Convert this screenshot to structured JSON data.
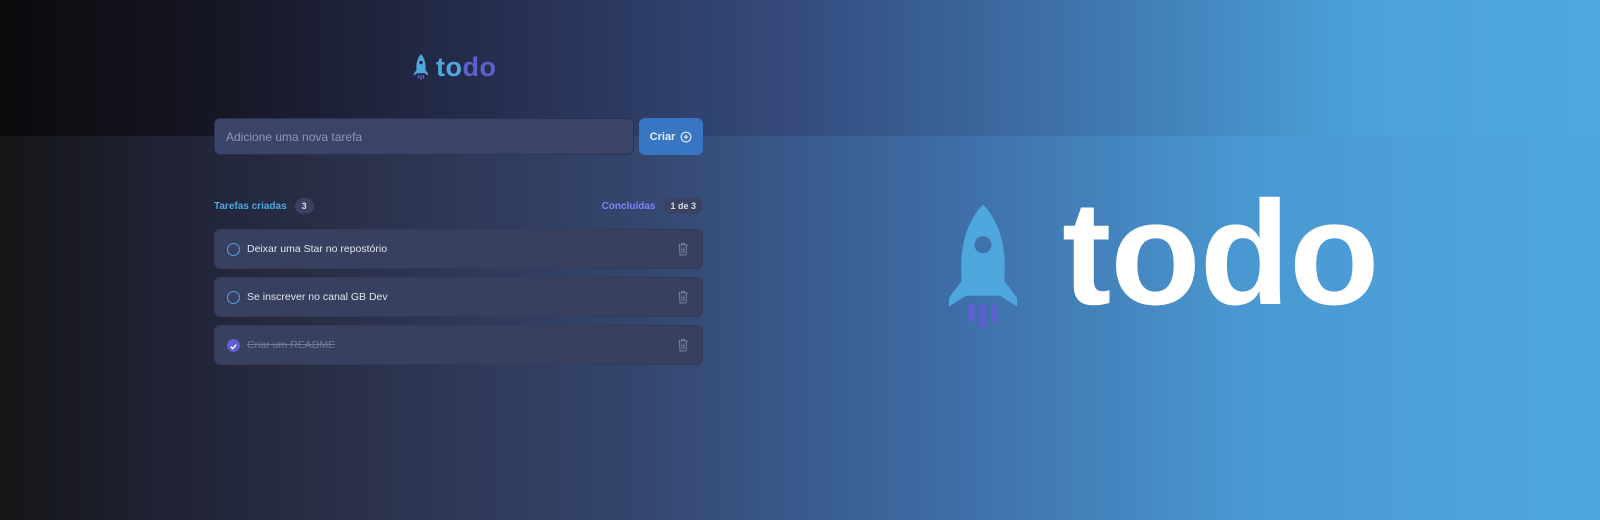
{
  "app": {
    "logo_to": "to",
    "logo_do": "do"
  },
  "form": {
    "placeholder": "Adicione uma nova tarefa",
    "create_label": "Criar"
  },
  "counters": {
    "created_label": "Tarefas criadas",
    "created_count": "3",
    "done_label": "Concluídas",
    "done_count": "1 de 3"
  },
  "tasks": [
    {
      "text": "Deixar uma Star no repostório",
      "completed": false
    },
    {
      "text": "Se inscrever no canal GB Dev",
      "completed": false
    },
    {
      "text": "Criar um README",
      "completed": true
    }
  ],
  "hero": {
    "word": "todo"
  },
  "colors": {
    "blue": "#4ea8de",
    "purple": "#5e60ce",
    "purple_light": "#8284fa",
    "button": "#3876c4"
  },
  "icons": {
    "logo": "rocket-icon",
    "create": "plus-circle-icon",
    "check": "check-icon",
    "delete": "trash-icon"
  }
}
